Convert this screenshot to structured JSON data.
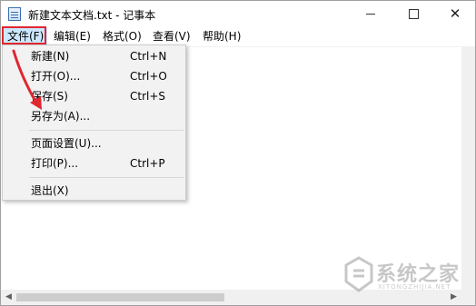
{
  "window": {
    "title": "新建文本文档.txt - 记事本"
  },
  "menubar": {
    "items": [
      {
        "label": "文件(F)"
      },
      {
        "label": "编辑(E)"
      },
      {
        "label": "格式(O)"
      },
      {
        "label": "查看(V)"
      },
      {
        "label": "帮助(H)"
      }
    ]
  },
  "file_menu": {
    "items": [
      {
        "label": "新建(N)",
        "shortcut": "Ctrl+N"
      },
      {
        "label": "打开(O)...",
        "shortcut": "Ctrl+O"
      },
      {
        "label": "保存(S)",
        "shortcut": "Ctrl+S"
      },
      {
        "label": "另存为(A)...",
        "shortcut": ""
      },
      {
        "label": "页面设置(U)...",
        "shortcut": ""
      },
      {
        "label": "打印(P)...",
        "shortcut": "Ctrl+P"
      },
      {
        "label": "退出(X)",
        "shortcut": ""
      }
    ]
  },
  "annotation": {
    "highlight_color": "#e0262f"
  },
  "watermark": {
    "text": "系统之家",
    "sub": "XITONGZHIJIA.NET"
  }
}
